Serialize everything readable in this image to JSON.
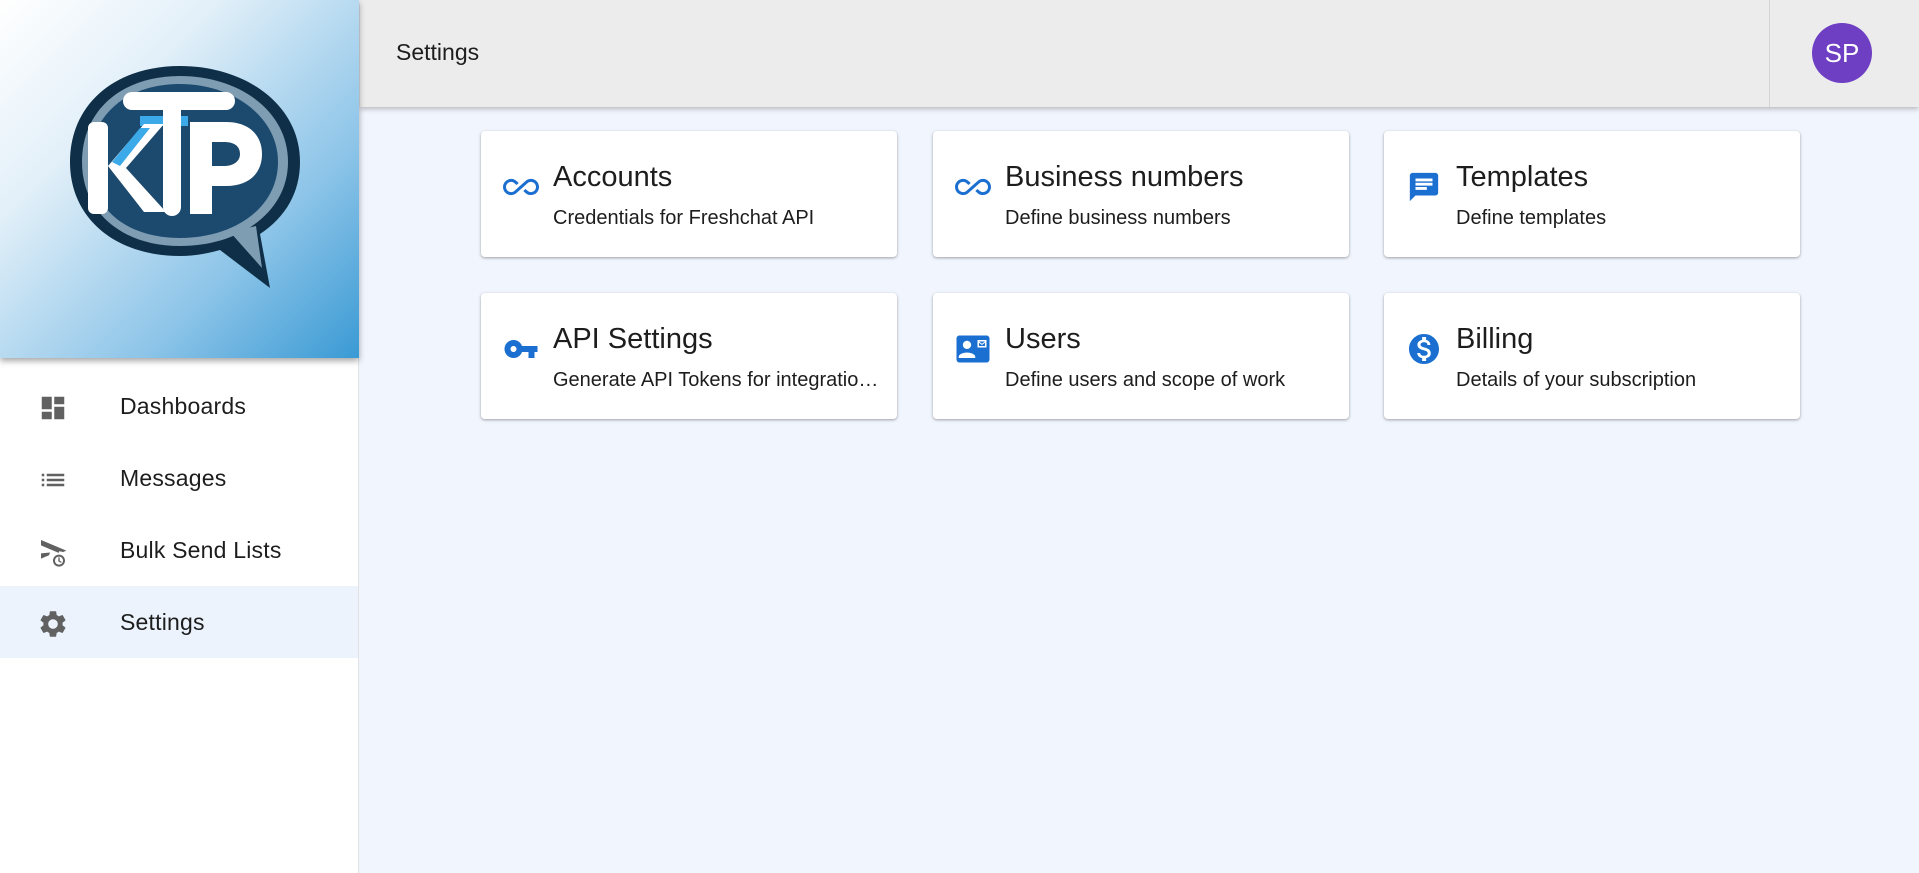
{
  "sidebar": {
    "logo_text": "KTP",
    "items": [
      {
        "label": "Dashboards",
        "icon": "dashboard-icon",
        "active": false
      },
      {
        "label": "Messages",
        "icon": "list-icon",
        "active": false
      },
      {
        "label": "Bulk Send Lists",
        "icon": "schedule-send-icon",
        "active": false
      },
      {
        "label": "Settings",
        "icon": "gear-icon",
        "active": true
      }
    ]
  },
  "header": {
    "title": "Settings",
    "avatar_initials": "SP"
  },
  "cards": [
    {
      "title": "Accounts",
      "description": "Credentials for Freshchat API",
      "icon": "infinity-icon"
    },
    {
      "title": "Business numbers",
      "description": "Define business numbers",
      "icon": "infinity-icon"
    },
    {
      "title": "Templates",
      "description": "Define templates",
      "icon": "chat-bubble-icon"
    },
    {
      "title": "API Settings",
      "description": "Generate API Tokens for integrations",
      "icon": "key-icon"
    },
    {
      "title": "Users",
      "description": "Define users and scope of work",
      "icon": "contact-card-icon"
    },
    {
      "title": "Billing",
      "description": "Details of your subscription",
      "icon": "dollar-circle-icon"
    }
  ],
  "colors": {
    "accent": "#1b6fd1",
    "avatar": "#6e3fc3",
    "active_nav": "#ecf3fc",
    "background": "#f1f5fd",
    "header": "#ececec",
    "nav_icon": "#616161"
  }
}
